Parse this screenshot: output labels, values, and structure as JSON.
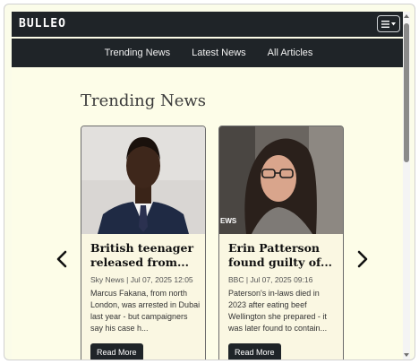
{
  "navbar": {
    "brand": "BULLEO"
  },
  "subnav": {
    "links": [
      "Trending News",
      "Latest News",
      "All Articles"
    ]
  },
  "section": {
    "title": "Trending News"
  },
  "cards": [
    {
      "headline": "British teenager released from...",
      "source_date": "Sky News | Jul 07, 2025 12:05",
      "excerpt": "Marcus Fakana, from north London, was arrested in Dubai last year - but campaigners say his case h...",
      "button": "Read More"
    },
    {
      "headline": "Erin Patterson found guilty of...",
      "source_date": "BBC | Jul 07, 2025 09:16",
      "excerpt": "Paterson's in-laws died in 2023 after eating beef Wellington she prepared - it was later found to contain...",
      "button": "Read More",
      "image_overlay": "EWS"
    }
  ],
  "carousel": {
    "prev_icon": "chevron-left-icon",
    "next_icon": "chevron-right-icon"
  },
  "colors": {
    "nav_bg": "#1f2428",
    "page_bg": "#fdfde8",
    "card_bg": "#faf7e2"
  }
}
